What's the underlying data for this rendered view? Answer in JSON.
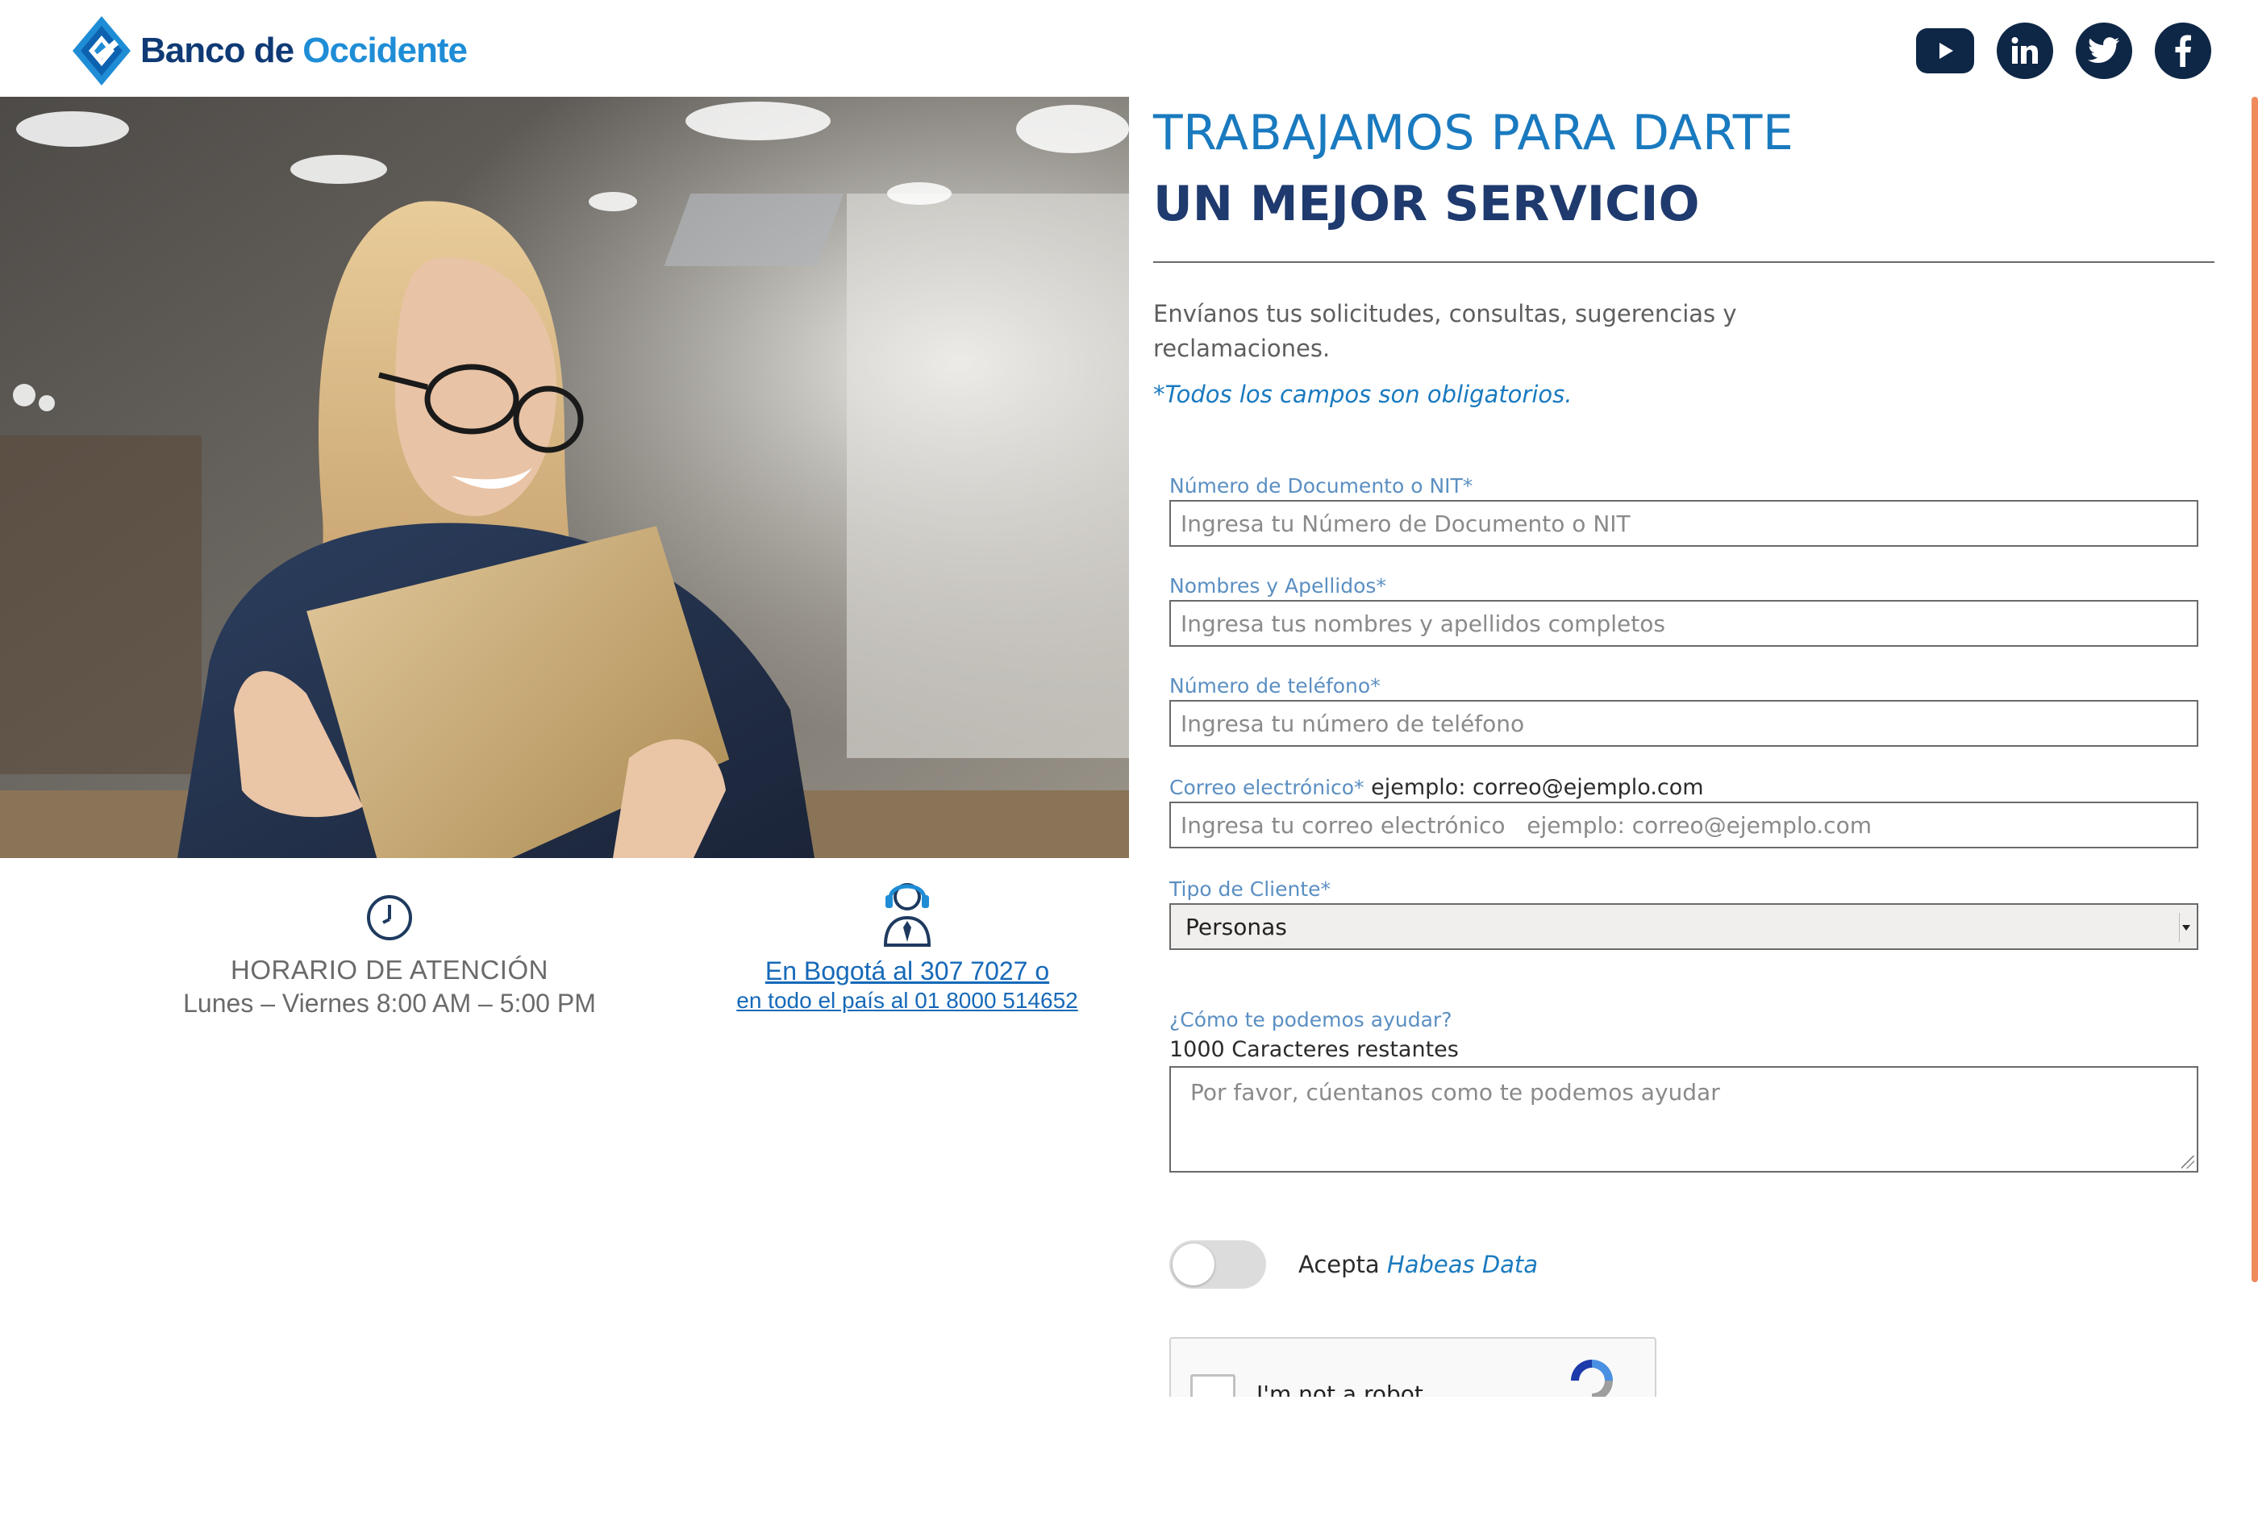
{
  "header": {
    "logo_text_main": "Banco de",
    "logo_text_accent": "Occidente",
    "social": [
      "youtube-icon",
      "linkedin-icon",
      "twitter-icon",
      "facebook-icon"
    ]
  },
  "info": {
    "hours_title": "HORARIO DE  ATENCIÓN",
    "hours_sub": "Lunes – Viernes 8:00 AM – 5:00 PM",
    "contact_line1": "En Bogotá al 307 7027 o",
    "contact_line2": "en todo el país al 01 8000 514652"
  },
  "main": {
    "title1": "TRABAJAMOS PARA DARTE",
    "title2": "UN MEJOR SERVICIO",
    "intro": "Envíanos tus solicitudes, consultas, sugerencias y reclamaciones.",
    "required_note": "*Todos los campos son obligatorios."
  },
  "form": {
    "document": {
      "label": "Número de Documento o NIT*",
      "placeholder": "Ingresa tu Número de Documento o NIT"
    },
    "names": {
      "label": "Nombres y Apellidos*",
      "placeholder": "Ingresa tus nombres y apellidos completos"
    },
    "phone": {
      "label": "Número de teléfono*",
      "placeholder": "Ingresa tu número de teléfono"
    },
    "email": {
      "label": "Correo electrónico*",
      "hint": " ejemplo: correo@ejemplo.com",
      "placeholder": "Ingresa tu correo electrónico   ejemplo: correo@ejemplo.com"
    },
    "client_type": {
      "label": "Tipo de Cliente*",
      "value": "Personas"
    },
    "help": {
      "label": "¿Cómo te podemos ayudar?",
      "chars_left": "1000 Caracteres restantes",
      "placeholder": "Por favor, cúentanos como te podemos ayudar"
    },
    "consent": {
      "prefix": "Acepta ",
      "link": "Habeas Data"
    },
    "captcha": {
      "label": "I'm not a robot"
    }
  },
  "colors": {
    "brand_dark": "#0f3a75",
    "brand_blue": "#1a7abf",
    "scroll_accent": "#f08a5d"
  }
}
